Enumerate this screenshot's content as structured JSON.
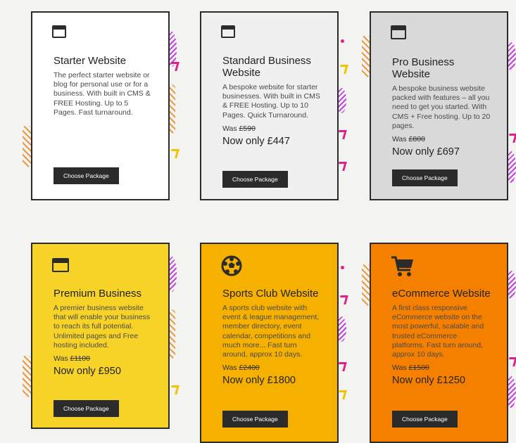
{
  "packages": [
    {
      "title": "Starter Website",
      "description": "The perfect starter website or blog for personal use or for a business. With built in CMS & FREE Hosting. Up to 5 Pages. Fast turnaround.",
      "was_label": "",
      "was_price": "",
      "now_price": "",
      "button": "Choose Package",
      "icon": "browser-window-icon",
      "bg": "#ffffff"
    },
    {
      "title": "Standard Business Website",
      "description": "A bespoke website for starter businesses. With built in CMS & FREE Hosting. Up to 10 Pages. Quick Turnaround.",
      "was_label": "Was",
      "was_price": "£590",
      "now_price": "Now only £447",
      "button": "Choose Package",
      "icon": "browser-window-icon",
      "bg": "#f0f0f0"
    },
    {
      "title": "Pro Business Website",
      "description": "A bespoke business website packed with features – all you need to get you started. With CMS + Free hosting. Up to 20 pages.",
      "was_label": "Was",
      "was_price": "£800",
      "now_price": "Now only £697",
      "button": "Choose Package",
      "icon": "browser-window-icon",
      "bg": "#d9d9d9"
    },
    {
      "title": "Premium Business",
      "description": "A premier business website that will enable your business to reach its full potential. Unlimited pages and Free hosting included.",
      "was_label": "Was",
      "was_price": "£1100",
      "now_price": "Now only £950",
      "button": "Choose Package",
      "icon": "browser-window-icon",
      "bg": "#f7d327"
    },
    {
      "title": "Sports Club Website",
      "description": "A sports club website with event & league management, member directory, event calendar, competitions and much more... Fast turn around, approx 10 days.",
      "was_label": "Was",
      "was_price": "£2400",
      "now_price": "Now only £1800",
      "button": "Choose Package",
      "icon": "soccer-ball-icon",
      "bg": "#f6b100"
    },
    {
      "title": "eCommerce Website",
      "description": "A first class responsive eCommerce website on the most powerful, scalable and trusted eCommerce platforms. Fast turn around, approx 10 days.",
      "was_label": "Was",
      "was_price": "£1500",
      "now_price": "Now only £1250",
      "button": "Choose Package",
      "icon": "shopping-cart-icon",
      "bg": "#f58000"
    }
  ]
}
